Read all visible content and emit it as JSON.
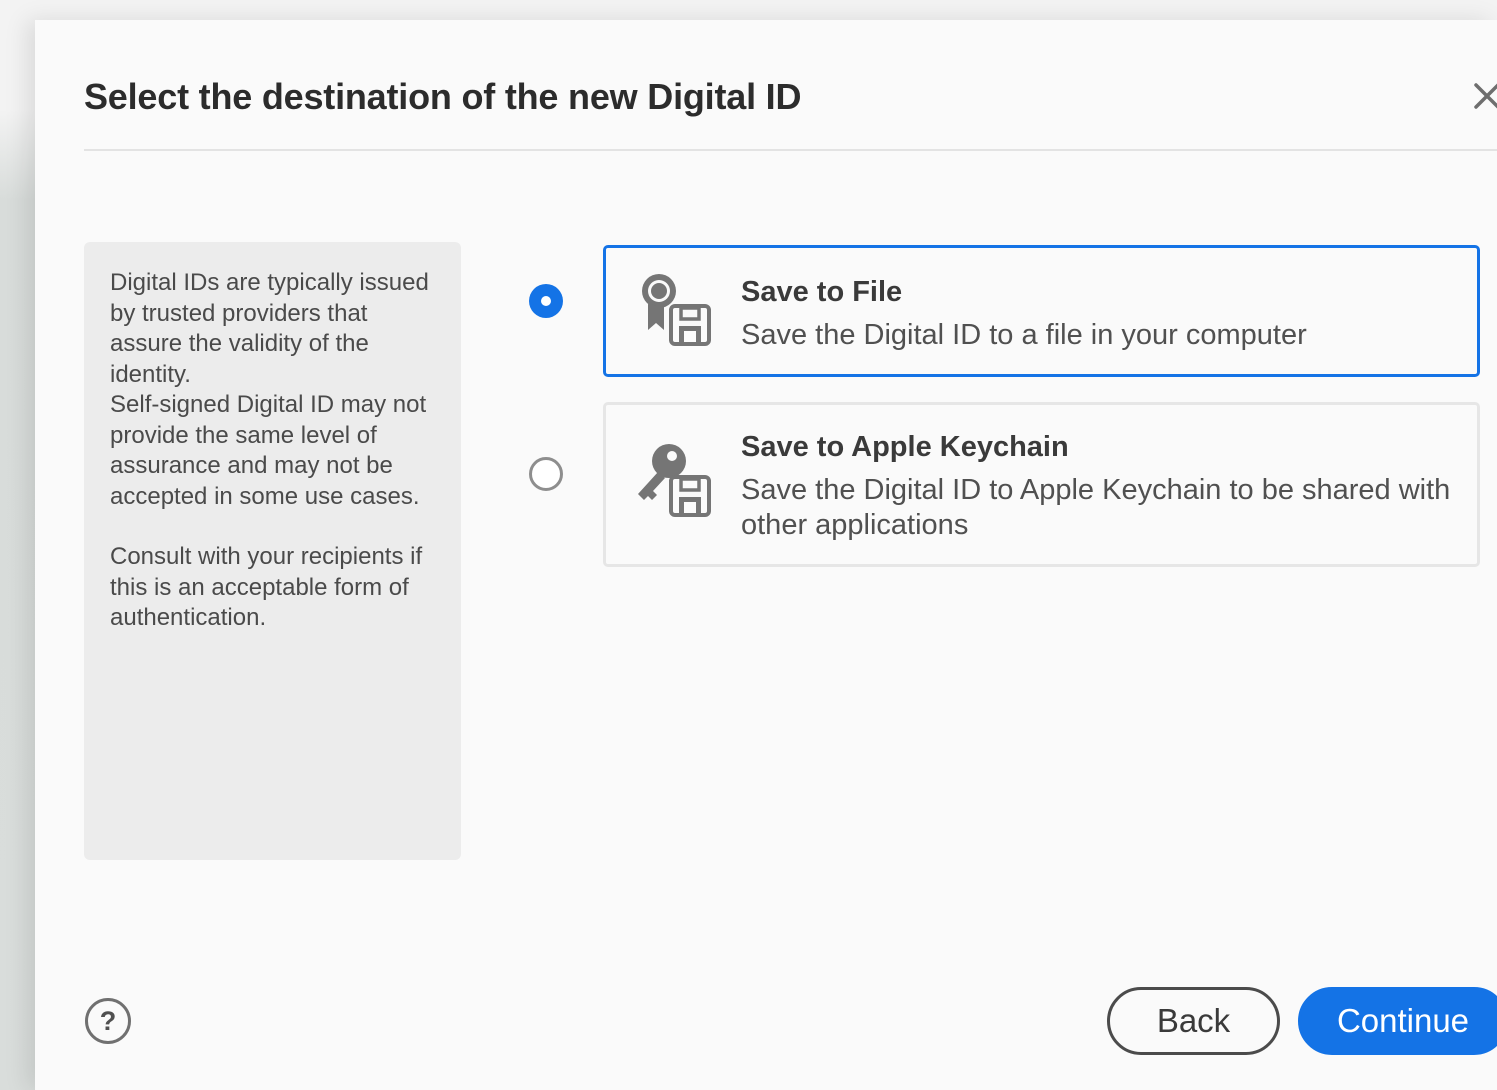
{
  "dialog": {
    "title": "Select the destination of the new Digital ID",
    "close_icon": "close-icon"
  },
  "info_panel": {
    "paragraph1": "Digital IDs are typically issued by trusted providers that assure the validity of the identity.",
    "paragraph1b": "Self-signed Digital ID may not provide the same level of assurance and may not be accepted in some use cases.",
    "paragraph2": "Consult with your recipients if this is an acceptable form of authentication."
  },
  "options": [
    {
      "title": "Save to File",
      "description": "Save the Digital ID to a file in your computer",
      "icon": "certificate-save-icon",
      "selected": true
    },
    {
      "title": "Save to Apple Keychain",
      "description": "Save the Digital ID to Apple Keychain to be shared with other applications",
      "icon": "key-save-icon",
      "selected": false
    }
  ],
  "footer": {
    "help_label": "?",
    "back_label": "Back",
    "continue_label": "Continue"
  },
  "colors": {
    "accent": "#1473e6",
    "panel_bg": "#ececec",
    "dialog_bg": "#fafafa"
  }
}
